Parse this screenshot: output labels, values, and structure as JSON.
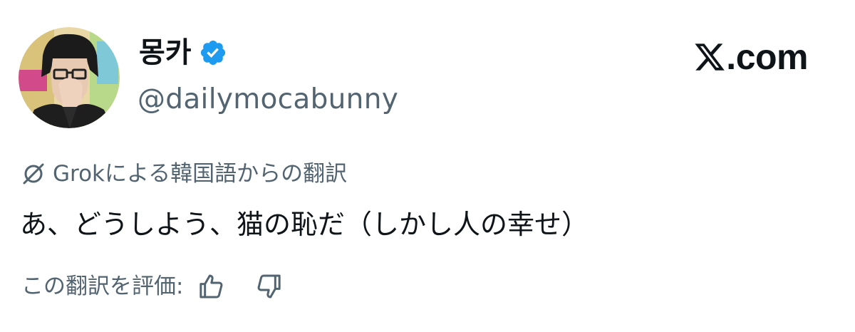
{
  "author": {
    "display_name": "몽카",
    "handle": "@dailymocabunny",
    "verified": true,
    "avatar_icon": "avatar"
  },
  "brand": {
    "suffix": ".com",
    "icon": "x-logo-icon"
  },
  "translation": {
    "label": "Grokによる韓国語からの翻訳",
    "icon": "grok-icon",
    "text": "あ、どうしよう、猫の恥だ（しかし人の幸せ）",
    "rate_label": "この翻訳を評価:",
    "thumb_up_icon": "thumbs-up-icon",
    "thumb_down_icon": "thumbs-down-icon"
  },
  "colors": {
    "primary_text": "#0f1419",
    "secondary_text": "#536471",
    "verified_blue": "#1d9bf0"
  }
}
